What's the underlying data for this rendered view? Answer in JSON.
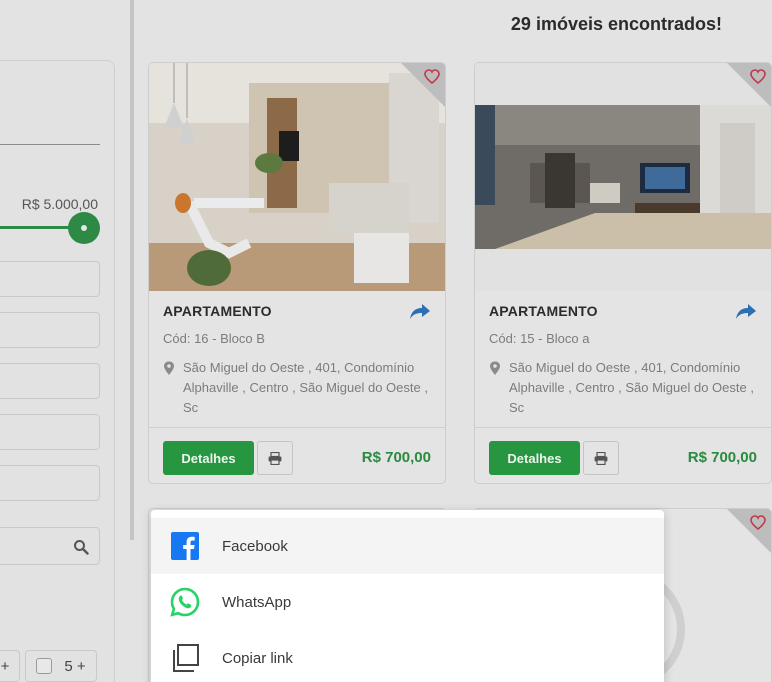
{
  "filters": {
    "price_max": "R$ 5.000,00",
    "room_options": [
      "+",
      "5 +"
    ]
  },
  "results": {
    "count_text": "29 imóveis encontrados!"
  },
  "cards": [
    {
      "type": "APARTAMENTO",
      "code": "Cód: 16 - Bloco B",
      "address": "São Miguel do Oeste , 401, Condomínio Alphaville , Centro , São Miguel do Oeste , Sc",
      "details_label": "Detalhes",
      "price": "R$ 700,00"
    },
    {
      "type": "APARTAMENTO",
      "code": "Cód: 15 - Bloco a",
      "address": "São Miguel do Oeste , 401, Condomínio Alphaville , Centro , São Miguel do Oeste , Sc",
      "details_label": "Detalhes",
      "price": "R$ 700,00"
    }
  ],
  "share_menu": {
    "options": [
      {
        "label": "Facebook",
        "icon": "facebook-icon"
      },
      {
        "label": "WhatsApp",
        "icon": "whatsapp-icon"
      },
      {
        "label": "Copiar link",
        "icon": "copy-icon"
      }
    ]
  },
  "colors": {
    "accent_green": "#279640",
    "price_green": "#2a8a40",
    "share_blue": "#2d6fb3",
    "facebook_blue": "#1877f2",
    "whatsapp_green": "#25d366",
    "heart_red": "#c0394b"
  }
}
